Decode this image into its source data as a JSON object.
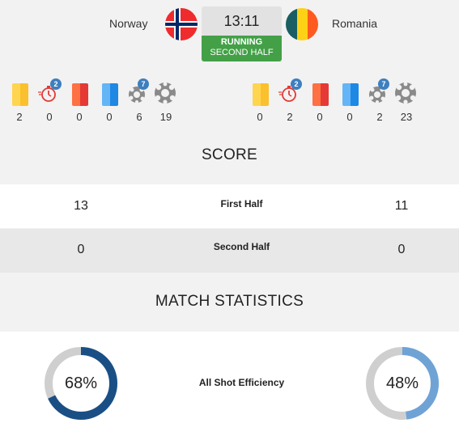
{
  "match": {
    "home_team": "Norway",
    "away_team": "Romania",
    "clock": "13:11",
    "status": "RUNNING",
    "period": "SECOND HALF"
  },
  "home_stats": [
    {
      "icon": "yellow-card-icon",
      "value": "2"
    },
    {
      "icon": "suspension-timer-icon",
      "value": "0",
      "badge": "2"
    },
    {
      "icon": "red-card-icon",
      "value": "0"
    },
    {
      "icon": "blue-card-icon",
      "value": "0"
    },
    {
      "icon": "seven-meter-ball-icon",
      "value": "6",
      "badge": "7"
    },
    {
      "icon": "ball-icon",
      "value": "19"
    }
  ],
  "away_stats": [
    {
      "icon": "yellow-card-icon",
      "value": "0"
    },
    {
      "icon": "suspension-timer-icon",
      "value": "2",
      "badge": "2"
    },
    {
      "icon": "red-card-icon",
      "value": "0"
    },
    {
      "icon": "blue-card-icon",
      "value": "0"
    },
    {
      "icon": "seven-meter-ball-icon",
      "value": "2",
      "badge": "7"
    },
    {
      "icon": "ball-icon",
      "value": "23"
    }
  ],
  "score": {
    "title": "SCORE",
    "rows": [
      {
        "label": "First Half",
        "home": "13",
        "away": "11"
      },
      {
        "label": "Second Half",
        "home": "0",
        "away": "0"
      }
    ]
  },
  "statistics": {
    "title": "MATCH STATISTICS",
    "rows": [
      {
        "label": "All Shot Efficiency",
        "home": "68%",
        "away": "48%",
        "home_value": 0.68,
        "away_value": 0.48
      }
    ]
  },
  "colors": {
    "running_green": "#43a047",
    "home_ring": "#1a4f85",
    "away_ring": "#6fa3d6",
    "ring_track": "#cfcfcf",
    "badge_blue": "#3d7fbf"
  }
}
